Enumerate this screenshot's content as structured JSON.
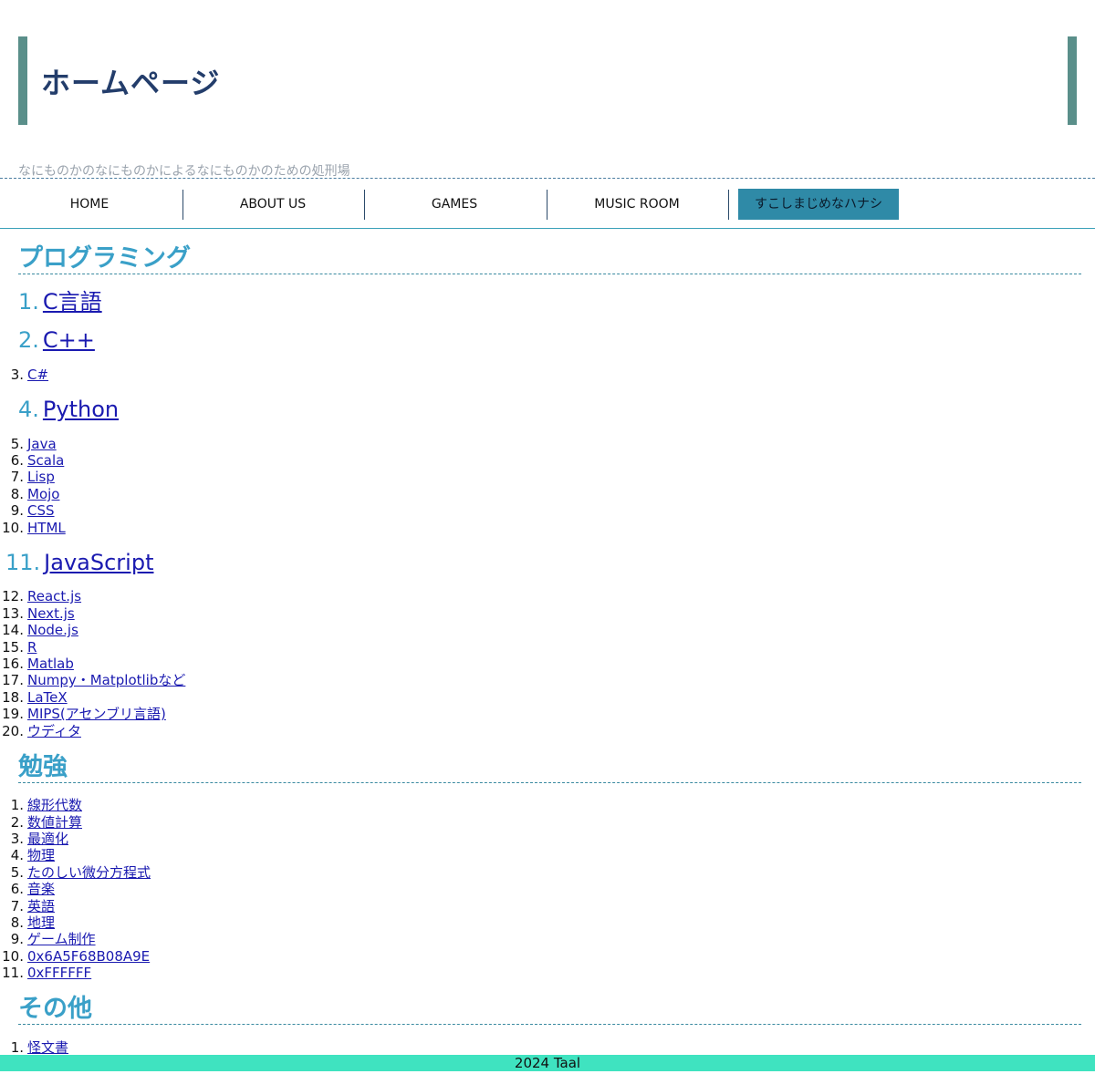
{
  "site": {
    "title": "ホームページ",
    "tagline": "なにものかのなにものかによるなにものかのための処刑場"
  },
  "nav": {
    "items": [
      {
        "label": "HOME"
      },
      {
        "label": "ABOUT US"
      },
      {
        "label": "GAMES"
      },
      {
        "label": "MUSIC ROOM"
      },
      {
        "label": "すこしまじめなハナシ"
      }
    ],
    "active_label": "すこしまじめなハナシ"
  },
  "sections": {
    "programming": {
      "title": "プログラミング",
      "items": [
        {
          "num": "1.",
          "label": "C言語"
        },
        {
          "num": "2.",
          "label": "C++"
        },
        {
          "num": "3.",
          "label": "C#"
        },
        {
          "num": "4.",
          "label": "Python"
        },
        {
          "num": "5.",
          "label": "Java"
        },
        {
          "num": "6.",
          "label": "Scala"
        },
        {
          "num": "7.",
          "label": "Lisp"
        },
        {
          "num": "8.",
          "label": "Mojo"
        },
        {
          "num": "9.",
          "label": "CSS"
        },
        {
          "num": "10.",
          "label": "HTML"
        },
        {
          "num": "11.",
          "label": "JavaScript"
        },
        {
          "num": "12.",
          "label": "React.js"
        },
        {
          "num": "13.",
          "label": "Next.js"
        },
        {
          "num": "14.",
          "label": "Node.js"
        },
        {
          "num": "15.",
          "label": "R"
        },
        {
          "num": "16.",
          "label": "Matlab"
        },
        {
          "num": "17.",
          "label": "Numpy・Matplotlibなど"
        },
        {
          "num": "18.",
          "label": "LaTeX"
        },
        {
          "num": "19.",
          "label": "MIPS(アセンブリ言語)"
        },
        {
          "num": "20.",
          "label": "ウディタ"
        }
      ]
    },
    "study": {
      "title": "勉強",
      "items": [
        {
          "num": "1.",
          "label": "線形代数"
        },
        {
          "num": "2.",
          "label": "数値計算"
        },
        {
          "num": "3.",
          "label": "最適化"
        },
        {
          "num": "4.",
          "label": "物理"
        },
        {
          "num": "5.",
          "label": "たのしい微分方程式"
        },
        {
          "num": "6.",
          "label": "音楽"
        },
        {
          "num": "7.",
          "label": "英語"
        },
        {
          "num": "8.",
          "label": "地理"
        },
        {
          "num": "9.",
          "label": "ゲーム制作"
        },
        {
          "num": "10.",
          "label": "0x6A5F68B08A9E"
        },
        {
          "num": "11.",
          "label": "0xFFFFFF"
        }
      ]
    },
    "other": {
      "title": "その他",
      "items": [
        {
          "num": "1.",
          "label": "怪文書"
        }
      ]
    }
  },
  "footer": {
    "text": "2024 Taal"
  },
  "colors": {
    "header_bar": "#5a8f8a",
    "title": "#233d6b",
    "section_title": "#3aa0c8",
    "nav_active": "#2f8aa7",
    "link": "#1a1ab0",
    "footer_bg": "#3fe3c0"
  }
}
